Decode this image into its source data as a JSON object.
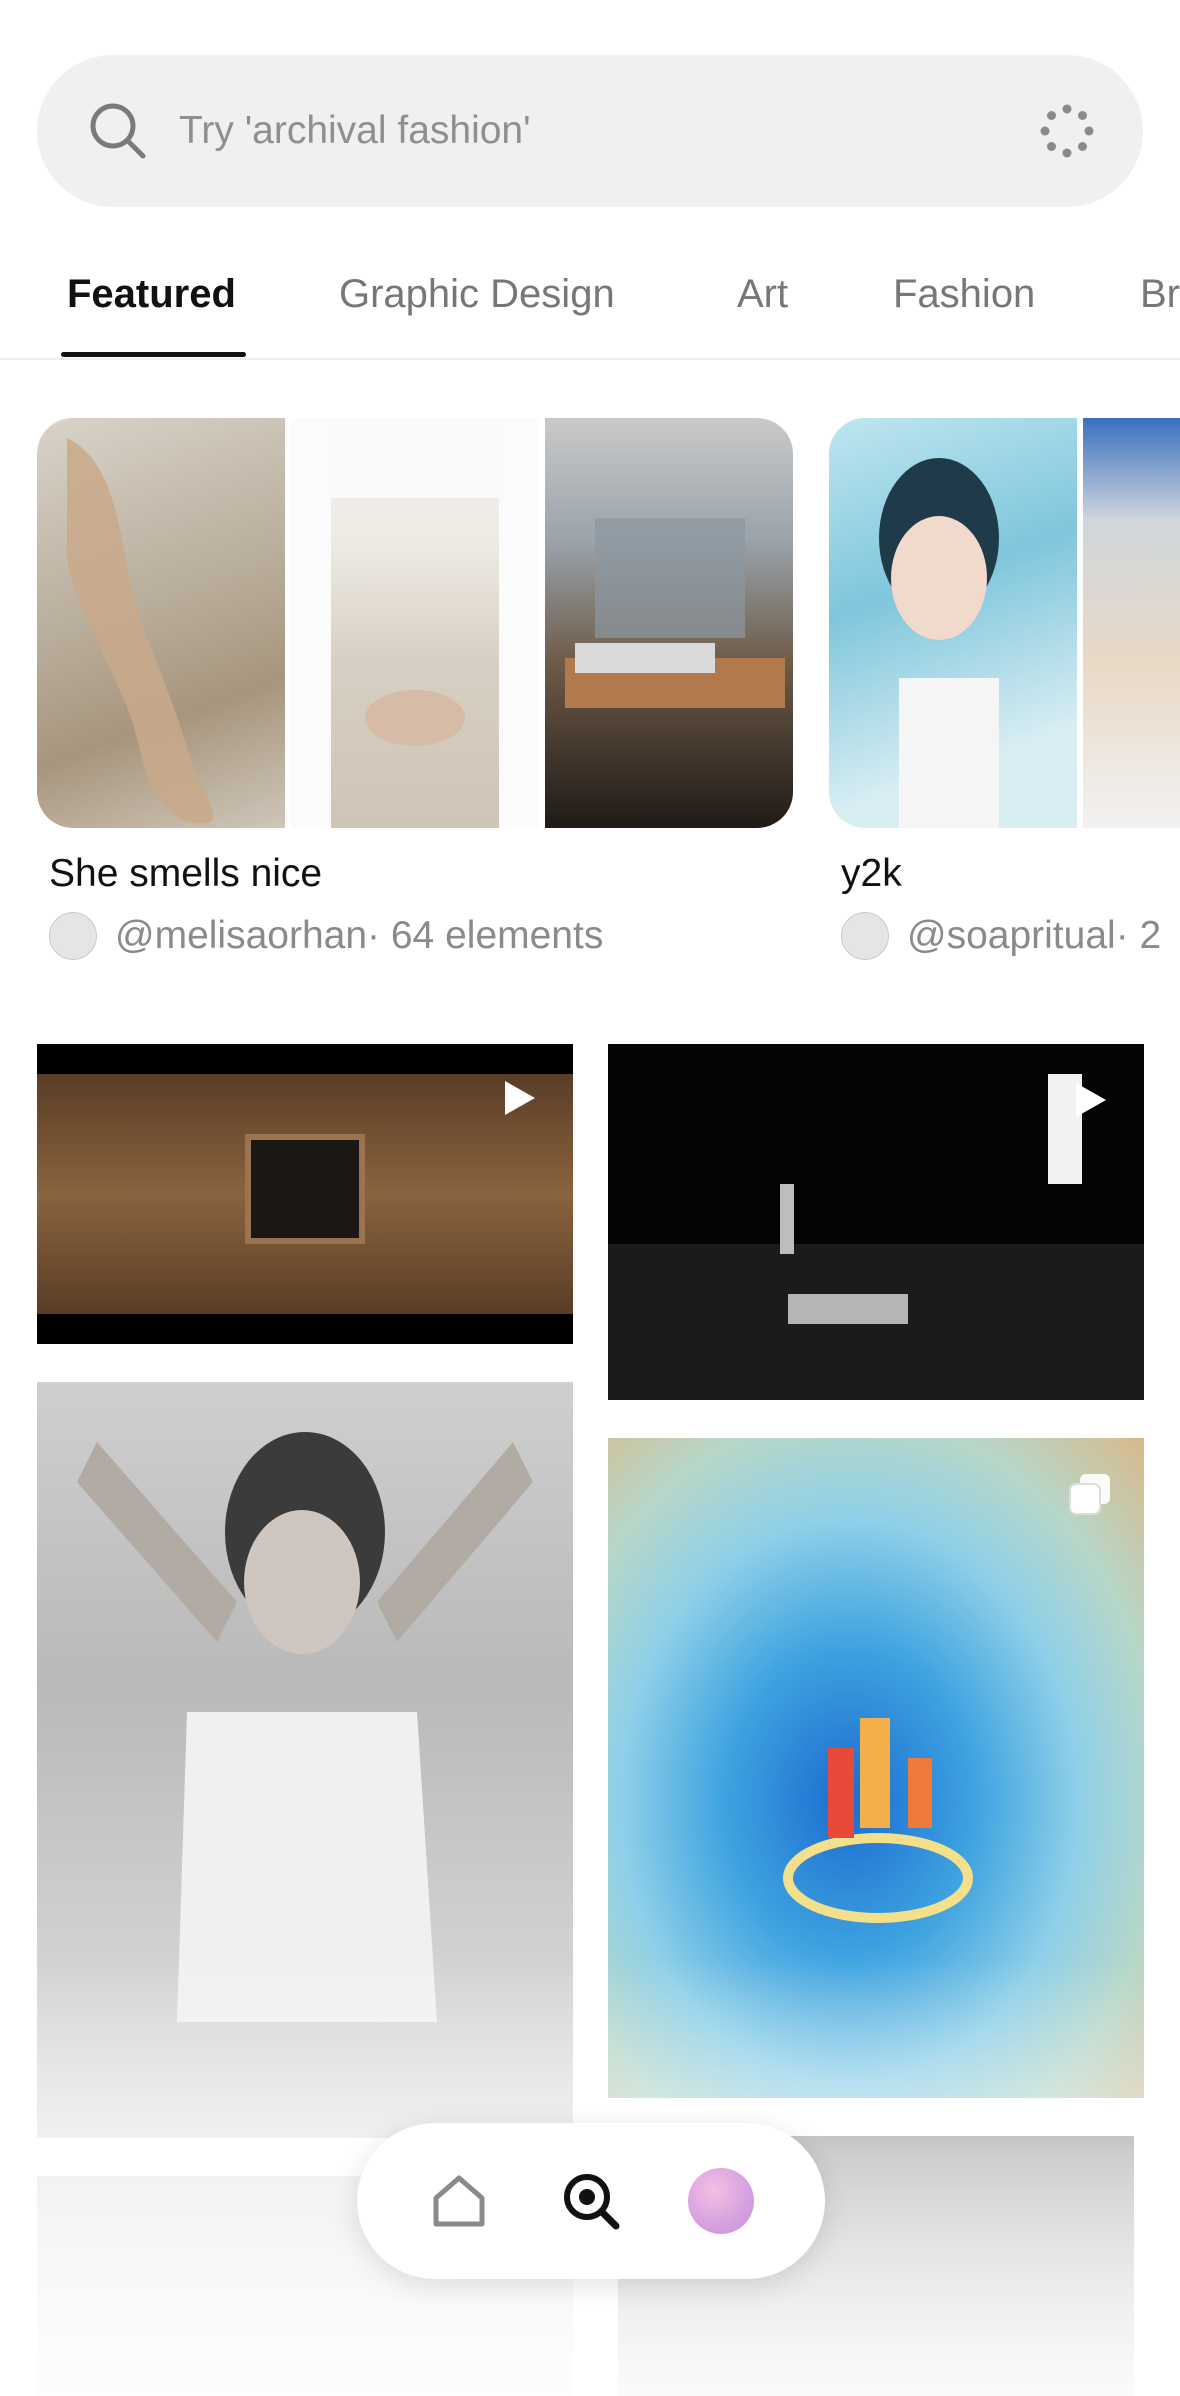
{
  "search": {
    "placeholder": "Try 'archival fashion'",
    "search_icon": "search-icon",
    "loading_icon": "dotted-spinner-icon"
  },
  "tabs": [
    {
      "label": "Featured",
      "active": true
    },
    {
      "label": "Graphic Design",
      "active": false
    },
    {
      "label": "Art",
      "active": false
    },
    {
      "label": "Fashion",
      "active": false
    },
    {
      "label": "Br",
      "active": false
    }
  ],
  "collections": [
    {
      "title": "She smells nice",
      "author": "@melisaorhan",
      "meta": " · 64 elements"
    },
    {
      "title": "y2k",
      "author": "@soapritual",
      "meta": " · 2"
    }
  ],
  "grid": {
    "badges": [
      "play-icon",
      "play-icon",
      "multiple-images-icon"
    ]
  },
  "nav": {
    "items": [
      "home-icon",
      "search-icon",
      "profile-avatar"
    ]
  },
  "colors": {
    "accent": "#111111",
    "muted_text": "#8a8a8a",
    "search_bg": "#f1f0f0"
  }
}
